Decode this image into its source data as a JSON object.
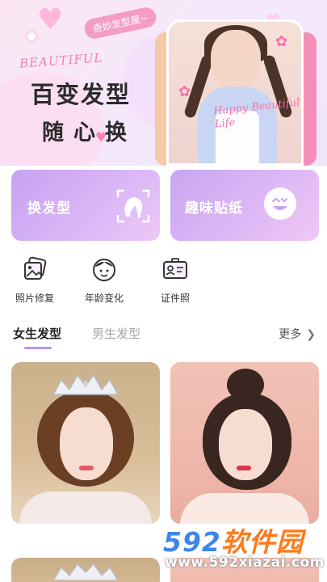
{
  "banner": {
    "tag": "奇妙发型屋~",
    "script_word": "BEAUTIFUL",
    "headline_line1": "百变发型",
    "headline_line2": "随心换",
    "photo_caption": "Happy Beautiful Life"
  },
  "actions": [
    {
      "label": "换发型",
      "icon": "hair-swap-icon"
    },
    {
      "label": "趣味贴纸",
      "icon": "smiley-sticker-icon"
    }
  ],
  "tools": [
    {
      "label": "照片修复",
      "icon": "photo-repair-icon"
    },
    {
      "label": "年龄变化",
      "icon": "age-change-icon"
    },
    {
      "label": "证件照",
      "icon": "id-photo-icon"
    }
  ],
  "tabs": {
    "active": "女生发型",
    "inactive": "男生发型",
    "more": "更多"
  },
  "watermark": {
    "number": "592",
    "brand": "软件园",
    "url": "www.592xiazai.com"
  },
  "colors": {
    "accent": "#b992f2",
    "card_gradient_start": "#c6a2f1",
    "card_gradient_end": "#edc9f6",
    "tag_pink": "#f59cc6",
    "watermark_blue": "#3f86e9",
    "watermark_orange": "#ff7a1a"
  }
}
